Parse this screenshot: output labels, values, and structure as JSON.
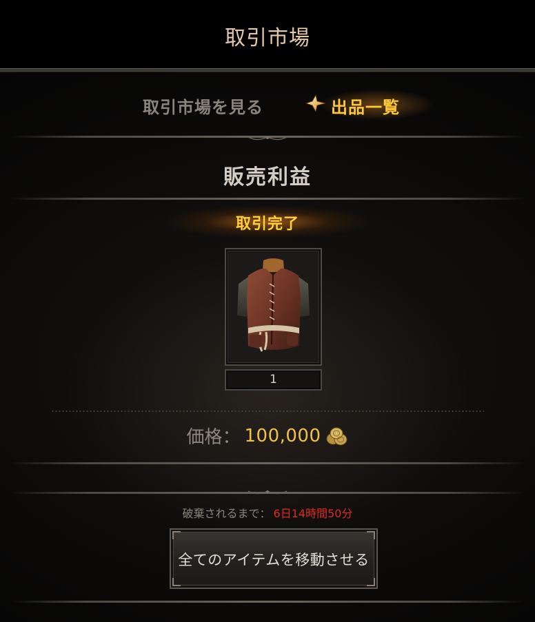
{
  "header": {
    "title": "取引市場"
  },
  "tabs": {
    "browse_label": "取引市場を見る",
    "listings_label": "出品一覧",
    "active": "出品一覧"
  },
  "section": {
    "title": "販売利益"
  },
  "status": {
    "label": "取引完了"
  },
  "item": {
    "icon": "leather-vest-icon",
    "quantity": "1"
  },
  "price": {
    "label": "価格：",
    "value": "100,000",
    "currency_icon": "gold-coins-icon"
  },
  "expiry": {
    "label": "破棄されるまで：",
    "value": "6日14時間50分"
  },
  "actions": {
    "move_all_label": "全てのアイテムを移動させる"
  },
  "colors": {
    "accent_gold": "#ffc93a",
    "price_gold": "#f2c04a",
    "warning_red": "#e02a1c",
    "title": "#e6c9a6"
  }
}
